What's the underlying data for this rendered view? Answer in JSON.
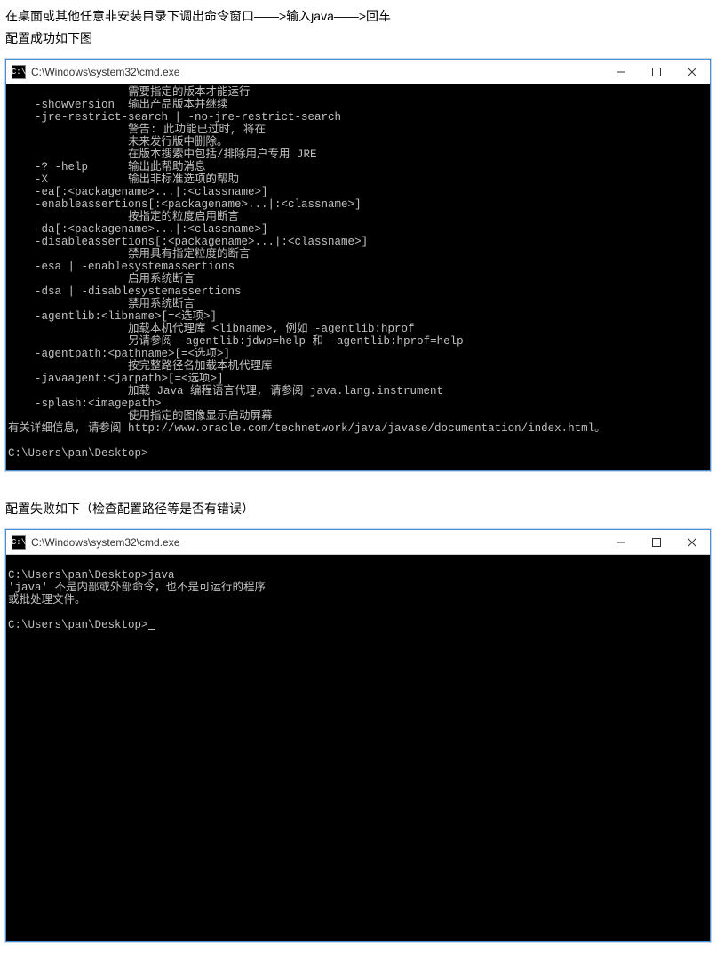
{
  "intro_line": "在桌面或其他任意非安装目录下调出命令窗口——>输入java——>回车",
  "caption_success": "配置成功如下图",
  "caption_failure": "配置失败如下（检查配置路径等是否有错误）",
  "cmd_title": "C:\\Windows\\system32\\cmd.exe",
  "terminal_success": "                  需要指定的版本才能运行\n    -showversion  输出产品版本并继续\n    -jre-restrict-search | -no-jre-restrict-search\n                  警告: 此功能已过时, 将在\n                  未来发行版中删除。\n                  在版本搜索中包括/排除用户专用 JRE\n    -? -help      输出此帮助消息\n    -X            输出非标准选项的帮助\n    -ea[:<packagename>...|:<classname>]\n    -enableassertions[:<packagename>...|:<classname>]\n                  按指定的粒度启用断言\n    -da[:<packagename>...|:<classname>]\n    -disableassertions[:<packagename>...|:<classname>]\n                  禁用具有指定粒度的断言\n    -esa | -enablesystemassertions\n                  启用系统断言\n    -dsa | -disablesystemassertions\n                  禁用系统断言\n    -agentlib:<libname>[=<选项>]\n                  加载本机代理库 <libname>, 例如 -agentlib:hprof\n                  另请参阅 -agentlib:jdwp=help 和 -agentlib:hprof=help\n    -agentpath:<pathname>[=<选项>]\n                  按完整路径名加载本机代理库\n    -javaagent:<jarpath>[=<选项>]\n                  加载 Java 编程语言代理, 请参阅 java.lang.instrument\n    -splash:<imagepath>\n                  使用指定的图像显示启动屏幕\n有关详细信息, 请参阅 http://www.oracle.com/technetwork/java/javase/documentation/index.html。\n\nC:\\Users\\pan\\Desktop>",
  "terminal_failure": "\nC:\\Users\\pan\\Desktop>java\n'java' 不是内部或外部命令，也不是可运行的程序\n或批处理文件。\n\nC:\\Users\\pan\\Desktop>",
  "icons": {
    "cmd_glyph": "C:\\",
    "minimize": "minimize-icon",
    "maximize": "maximize-icon",
    "close": "close-icon"
  }
}
